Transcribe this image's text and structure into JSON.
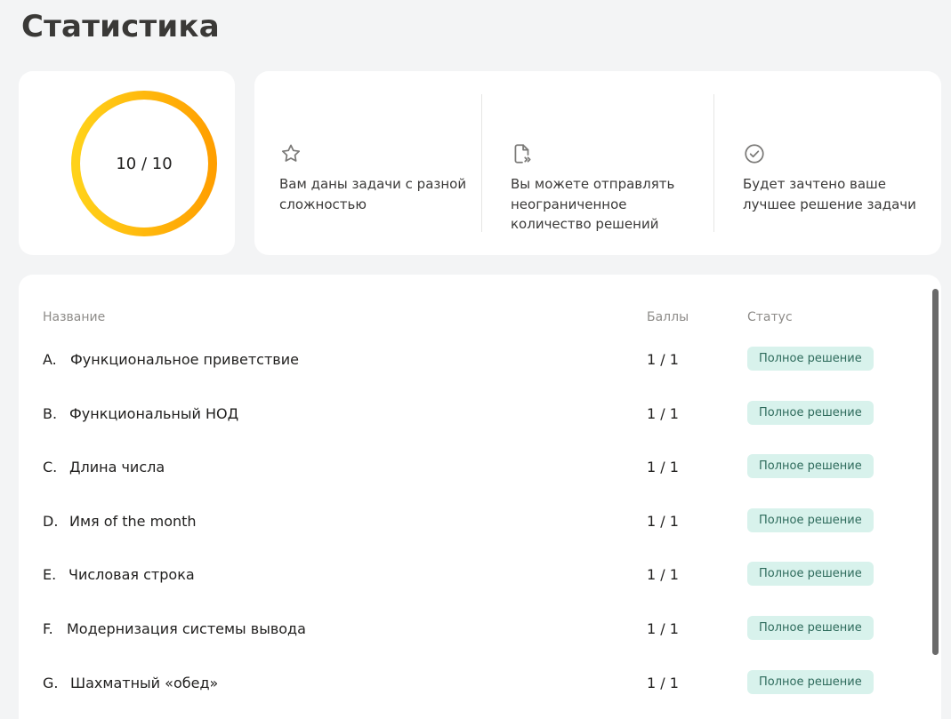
{
  "page": {
    "title": "Статистика"
  },
  "progress": {
    "text": "10 / 10",
    "solved": 10,
    "total": 10,
    "fraction": 1.0,
    "colors": {
      "start": "#ffd21a",
      "end": "#ff9f00"
    }
  },
  "info": [
    {
      "icon": "star-icon",
      "text": "Вам даны задачи с разной сложностью"
    },
    {
      "icon": "file-forward-icon",
      "text": "Вы можете отправлять неограниченное количество решений"
    },
    {
      "icon": "check-circle-icon",
      "text": "Будет зачтено ваше лучшее решение задачи"
    }
  ],
  "table": {
    "headers": {
      "name": "Название",
      "score": "Баллы",
      "status": "Статус"
    },
    "rows": [
      {
        "letter": "A.",
        "name": "Функциональное приветствие",
        "score": "1 / 1",
        "status": "Полное решение"
      },
      {
        "letter": "B.",
        "name": "Функциональный НОД",
        "score": "1 / 1",
        "status": "Полное решение"
      },
      {
        "letter": "C.",
        "name": "Длина числа",
        "score": "1 / 1",
        "status": "Полное решение"
      },
      {
        "letter": "D.",
        "name": "Имя of the month",
        "score": "1 / 1",
        "status": "Полное решение"
      },
      {
        "letter": "E.",
        "name": "Числовая строка",
        "score": "1 / 1",
        "status": "Полное решение"
      },
      {
        "letter": "F.",
        "name": "Модернизация системы вывода",
        "score": "1 / 1",
        "status": "Полное решение"
      },
      {
        "letter": "G.",
        "name": "Шахматный «обед»",
        "score": "1 / 1",
        "status": "Полное решение"
      }
    ]
  },
  "colors": {
    "background": "#f3f4f5",
    "card": "#ffffff",
    "status_bg": "#d8f2ec",
    "status_text": "#2e6b5c"
  }
}
